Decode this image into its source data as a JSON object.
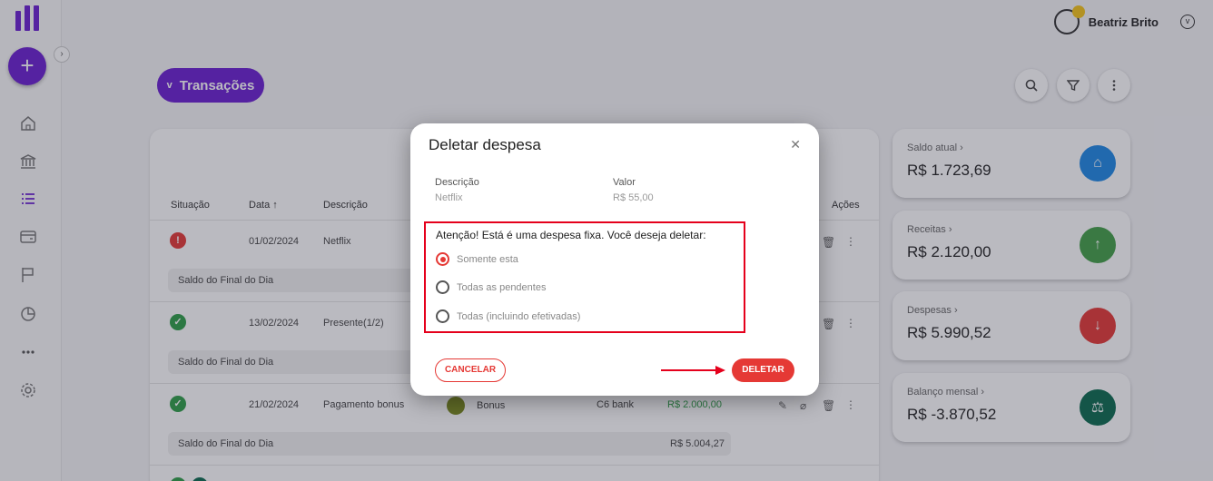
{
  "user": {
    "name": "Beatriz Brito"
  },
  "toolbar": {
    "transacoes_label": "Transações"
  },
  "table": {
    "headers": {
      "situacao": "Situação",
      "data": "Data",
      "descricao": "Descrição",
      "acoes": "Ações"
    },
    "rows": [
      {
        "date": "01/02/2024",
        "description": "Netflix",
        "status": "pending"
      },
      {
        "date": "13/02/2024",
        "description": "Presente(1/2)",
        "status": "done"
      },
      {
        "date": "21/02/2024",
        "description": "Pagamento bonus",
        "category": "Bonus",
        "account": "C6 bank",
        "value": "R$ 2.000,00",
        "status": "done"
      }
    ],
    "saldo_label": "Saldo do Final do Dia",
    "saldo_value_row3": "R$ 5.004,27"
  },
  "cards": [
    {
      "label": "Saldo atual",
      "value": "R$ 1.723,69",
      "color": "#1e88e5"
    },
    {
      "label": "Receitas",
      "value": "R$ 2.120,00",
      "color": "#43a047"
    },
    {
      "label": "Despesas",
      "value": "R$ 5.990,52",
      "color": "#e53935"
    },
    {
      "label": "Balanço mensal",
      "value": "R$ -3.870,52",
      "color": "#0b6b4f"
    }
  ],
  "modal": {
    "title": "Deletar despesa",
    "descricao_label": "Descrição",
    "descricao_value": "Netflix",
    "valor_label": "Valor",
    "valor_value": "R$ 55,00",
    "warning": "Atenção! Está é uma despesa fixa. Você deseja deletar:",
    "options": [
      "Somente esta",
      "Todas as pendentes",
      "Todas (incluindo efetivadas)"
    ],
    "selected_option": "Somente esta",
    "cancel_label": "CANCELAR",
    "delete_label": "DELETAR"
  }
}
